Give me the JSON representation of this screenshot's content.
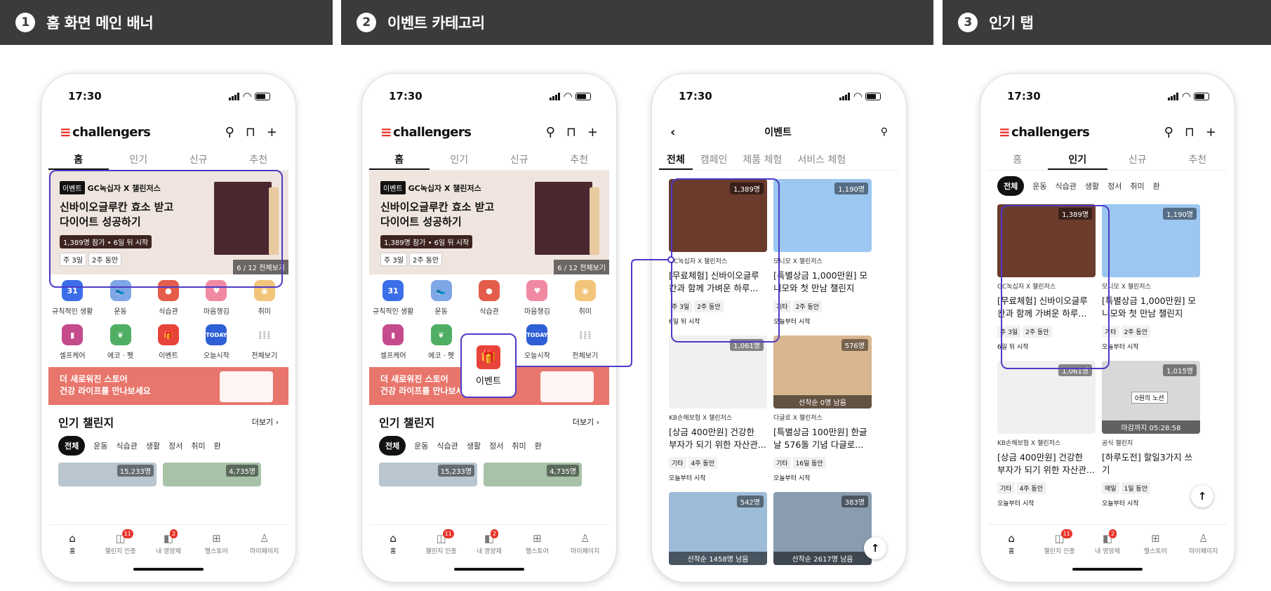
{
  "headers": [
    {
      "num": "1",
      "title": "홈 화면 메인 배너"
    },
    {
      "num": "2",
      "title": "이벤트 카테고리"
    },
    {
      "num": "3",
      "title": "인기 탭"
    }
  ],
  "status": {
    "time": "17:30"
  },
  "app": {
    "brand": "challengers"
  },
  "tabs": [
    "홈",
    "인기",
    "신규",
    "추천"
  ],
  "banner": {
    "badge": "이벤트",
    "sub": "GC녹십자 X 챌린저스",
    "title": "신바이오글루칸 효소 받고 다이어트 성공하기",
    "meta": "1,389명 참가 • 6일 뒤 시작",
    "chip1": "주 3일",
    "chip2": "2주 동안",
    "pager": "6 / 12 전체보기"
  },
  "categories": [
    "규칙적인 생활",
    "운동",
    "식습관",
    "마음챙김",
    "취미",
    "셀프케어",
    "에코 · 펫",
    "이벤트",
    "오늘시작",
    "전체보기"
  ],
  "store": {
    "line1": "더 새로워진 스토어",
    "line2": "건강 라이프를 만나보세요"
  },
  "popular": {
    "title": "인기 챌린지",
    "more": "더보기"
  },
  "pills": [
    "전체",
    "운동",
    "식습관",
    "생활",
    "정서",
    "취미",
    "환"
  ],
  "peek": [
    "15,233명",
    "4,735명"
  ],
  "nav": [
    "홈",
    "챌린지 인증",
    "내 영양제",
    "헬스토어",
    "마이페이지"
  ],
  "nav_badges": [
    "11",
    "2"
  ],
  "event": {
    "title": "이벤트",
    "tabs": [
      "전체",
      "캠페인",
      "제품 체험",
      "서비스 체험"
    ],
    "callout": "이벤트"
  },
  "cards": [
    {
      "count": "1,389명",
      "org": "GC녹십자 X 챌린저스",
      "t1": "[무료체험] 신바이오글루",
      "t2": "칸과 함께 가벼운 하루...",
      "c1": "주 3일",
      "c2": "2주 동안",
      "start": "6일 뒤 시작"
    },
    {
      "count": "1,190명",
      "org": "모니모 X 챌린저스",
      "t1": "[특별상금 1,000만원] 모",
      "t2": "니모와 첫 만남 챌린지",
      "c1": "기타",
      "c2": "2주 동안",
      "start": "오늘부터 시작"
    },
    {
      "count": "1,061명",
      "org": "KB손해보험 X 챌린저스",
      "t1": "[상금 400만원] 건강한",
      "t2": "부자가 되기 위한 자산관...",
      "c1": "기타",
      "c2": "4주 동안",
      "start": "오늘부터 시작"
    },
    {
      "count": "576명",
      "overlay": "선착순 0명 남음",
      "org": "다글로 X 챌린저스",
      "t1": "[특별상금 100만원] 한글",
      "t2": "날 576돌 기념 다글로...",
      "c1": "기타",
      "c2": "16일 동안",
      "start": "오늘부터 시작"
    },
    {
      "count": "542명",
      "overlay": "선착순 1458명 남음"
    },
    {
      "count": "383명",
      "overlay": "선착순 2617명 남음"
    }
  ],
  "pop_pills": [
    "전체",
    "운동",
    "식습관",
    "생활",
    "정서",
    "취미",
    "환"
  ],
  "pop_cards": [
    {
      "count": "1,389명",
      "org": "GC녹십자 X 챌린저스",
      "t1": "[무료체험] 신바이오글루",
      "t2": "칸과 함께 가벼운 하루...",
      "c1": "주 3일",
      "c2": "2주 동안",
      "start": "6일 뒤 시작"
    },
    {
      "count": "1,190명",
      "org": "모니모 X 챌린저스",
      "t1": "[특별상금 1,000만원] 모",
      "t2": "니모와 첫 만남 챌린지",
      "c1": "기타",
      "c2": "2주 동안",
      "start": "오늘부터 시작"
    },
    {
      "count": "1,061명",
      "org": "KB손해보험 X 챌린저스",
      "t1": "[상금 400만원] 건강한",
      "t2": "부자가 되기 위한 자산관...",
      "c1": "기타",
      "c2": "4주 동안",
      "start": "오늘부터 시작"
    },
    {
      "count": "1,015명",
      "overlay": "마감까지 05:28:58",
      "tag": "0원의 노션",
      "org": "공식 챌린지",
      "t1": "[하루도전] 할일3가지 쓰",
      "t2": "기",
      "c1": "매일",
      "c2": "1일 동안",
      "start": "오늘부터 시작"
    }
  ],
  "colors": {
    "highlight": "#4d3ac8",
    "brand": "#e8352b",
    "header_bg": "#3b3b3b",
    "store_bg": "#e8766c",
    "banner_bg": "#efe5de"
  }
}
